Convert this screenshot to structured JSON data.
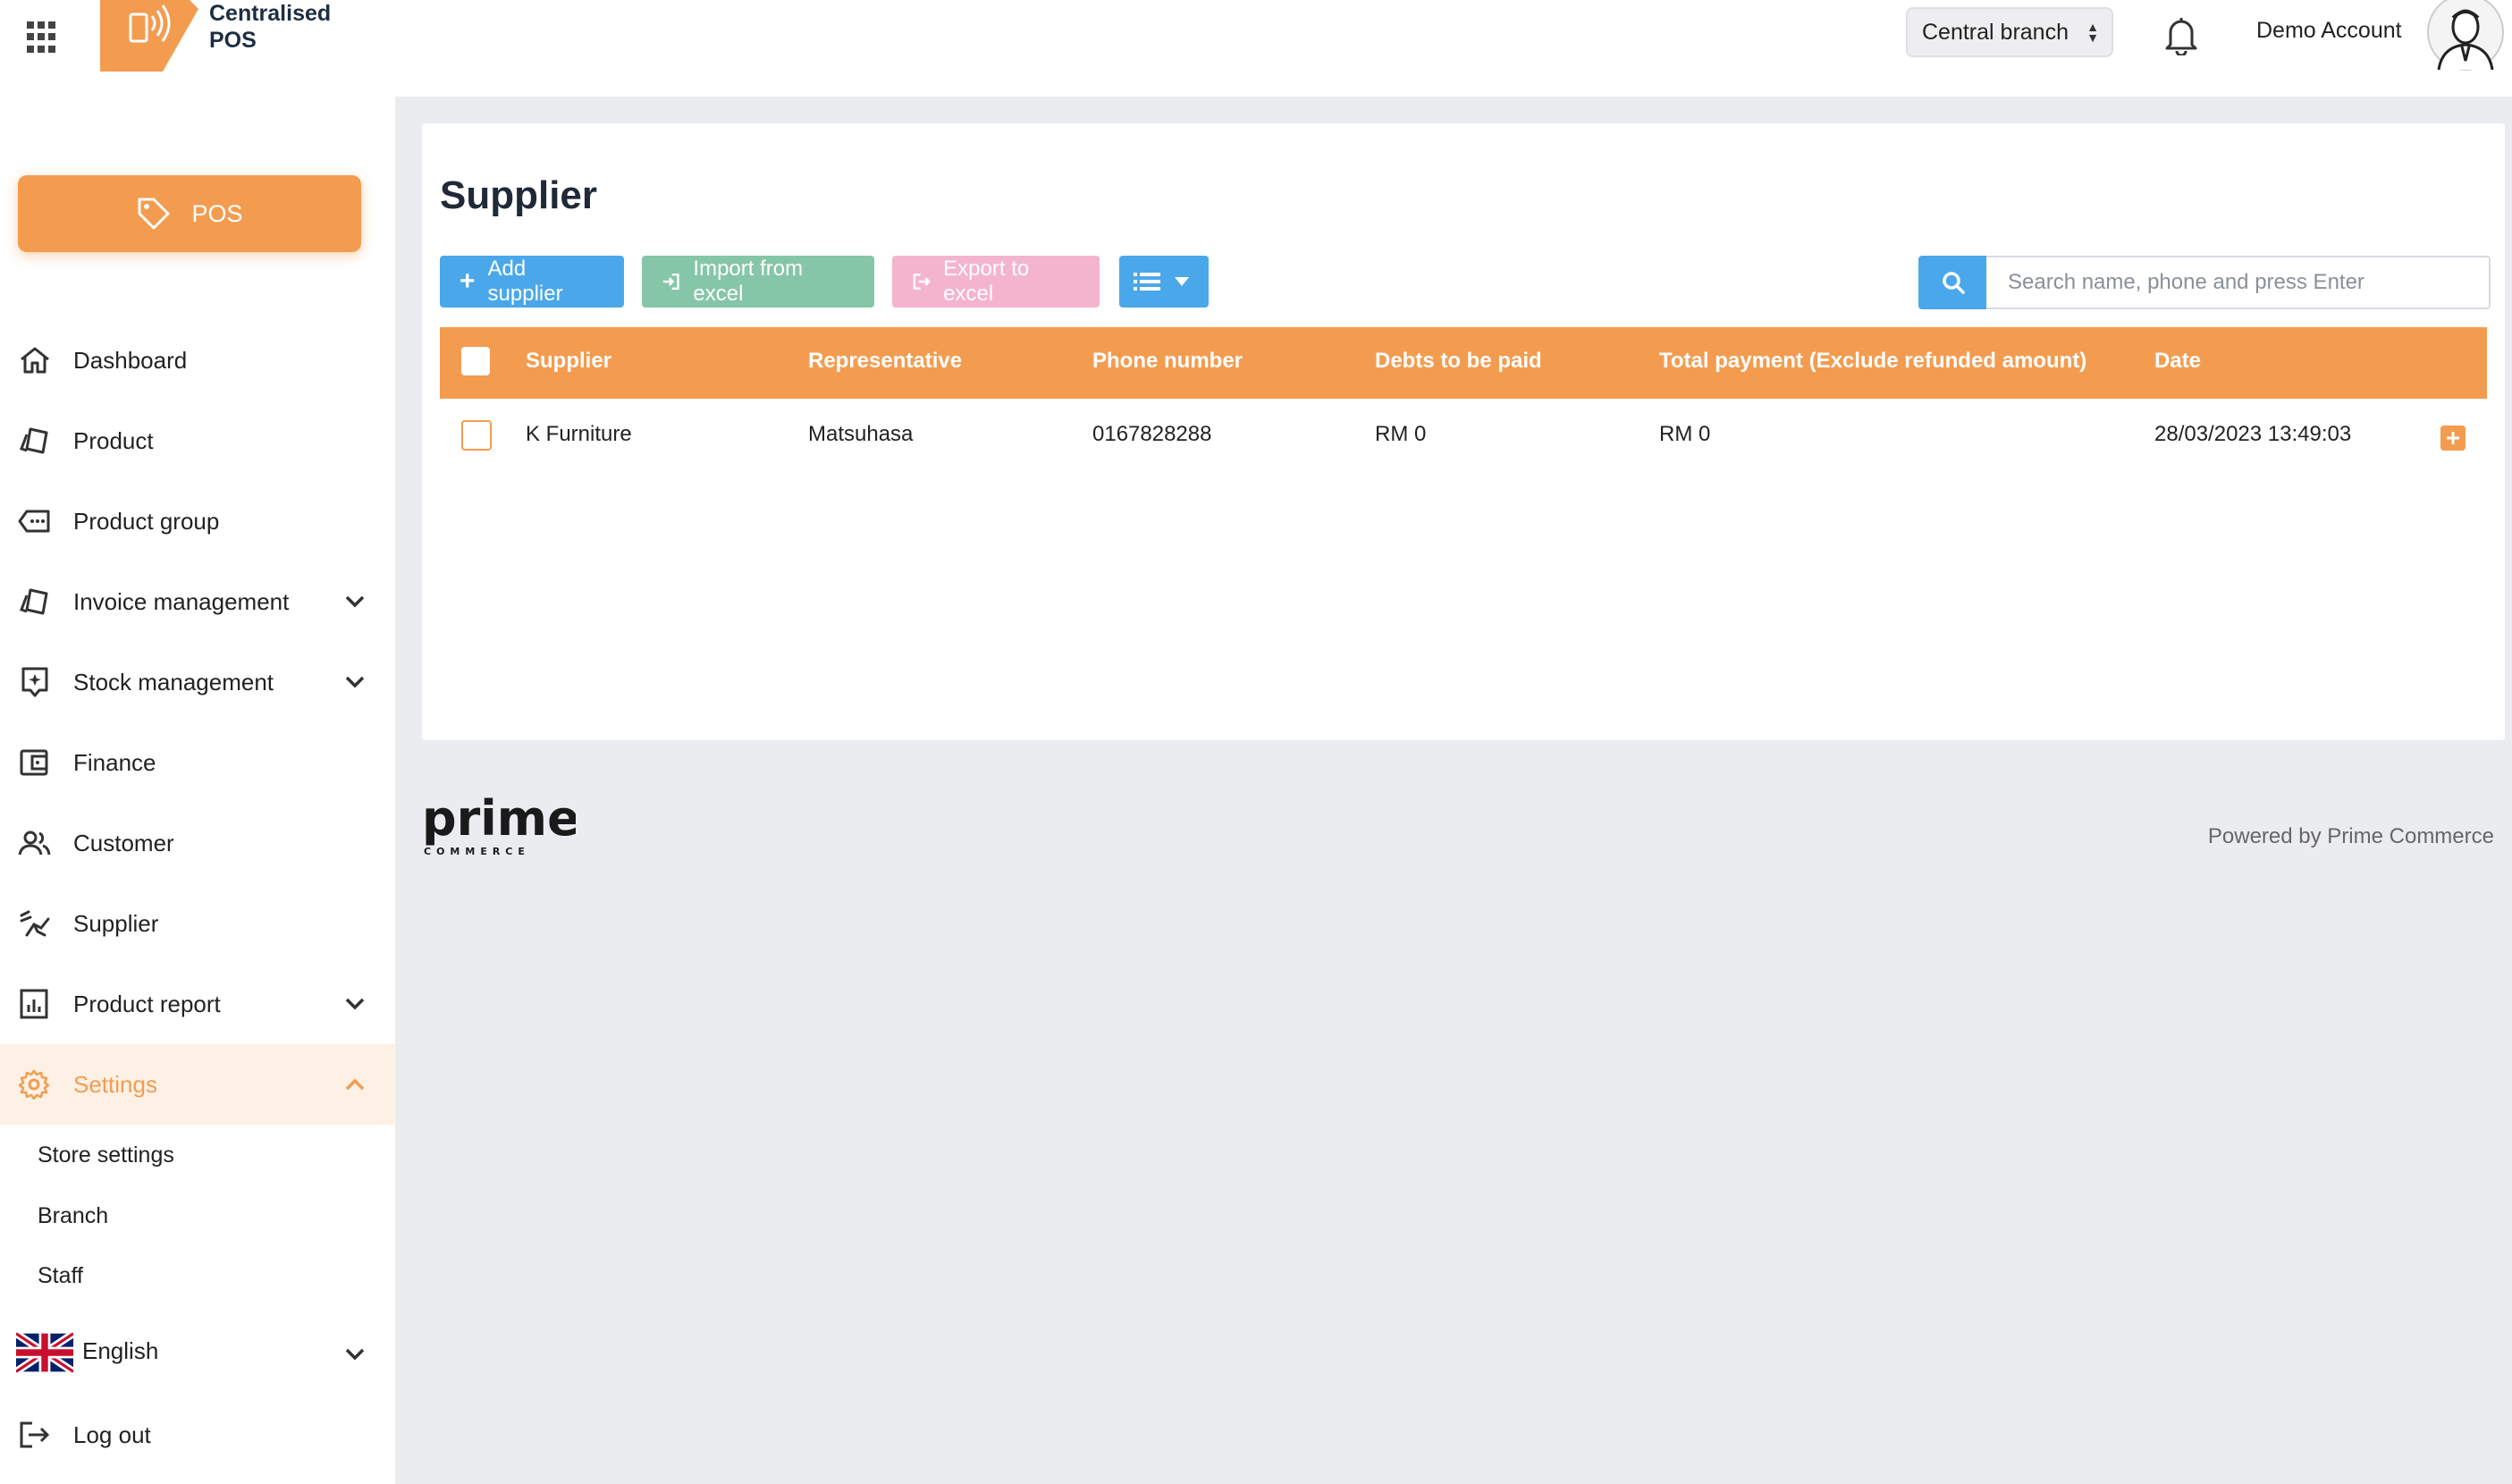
{
  "header": {
    "brand_line1": "Centralised",
    "brand_line2": "POS",
    "branch": "Central branch",
    "account_name": "Demo Account"
  },
  "sidebar": {
    "pos_label": "POS",
    "items": [
      {
        "label": "Dashboard",
        "icon": "home-icon"
      },
      {
        "label": "Product",
        "icon": "product-icon"
      },
      {
        "label": "Product group",
        "icon": "tag-group-icon"
      },
      {
        "label": "Invoice management",
        "icon": "invoice-icon"
      },
      {
        "label": "Stock management",
        "icon": "stock-icon"
      },
      {
        "label": "Finance",
        "icon": "wallet-icon"
      },
      {
        "label": "Customer",
        "icon": "people-icon"
      },
      {
        "label": "Supplier",
        "icon": "supplier-icon"
      },
      {
        "label": "Product report",
        "icon": "report-icon"
      },
      {
        "label": "Settings",
        "icon": "gear-icon"
      }
    ],
    "settings_sub": [
      "Store settings",
      "Branch",
      "Staff"
    ],
    "language": "English",
    "logout": "Log out"
  },
  "main": {
    "title": "Supplier",
    "buttons": {
      "add": "Add supplier",
      "import": "Import from excel",
      "export": "Export to excel"
    },
    "search": {
      "placeholder": "Search name, phone and press Enter"
    },
    "table": {
      "columns": [
        "Supplier",
        "Representative",
        "Phone number",
        "Debts to be paid",
        "Total payment (Exclude refunded amount)",
        "Date"
      ],
      "rows": [
        {
          "supplier": "K Furniture",
          "representative": "Matsuhasa",
          "phone": "0167828288",
          "debts": "RM 0",
          "total_payment": "RM 0",
          "date": "28/03/2023 13:49:03"
        }
      ]
    }
  },
  "footer": {
    "logo_text": "prime",
    "logo_subtext": "COMMERCE",
    "powered_by": "Powered by Prime Commerce"
  },
  "colors": {
    "accent": "#f39c50",
    "primary": "#4aa8ea",
    "import": "#86c6a8",
    "export": "#f4b4ce"
  }
}
